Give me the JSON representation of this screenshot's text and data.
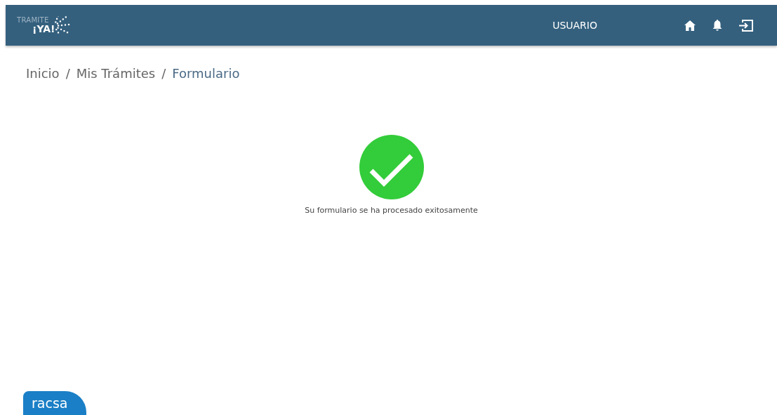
{
  "header": {
    "logo": {
      "top": "TRAMITE",
      "bottom": "¡YA!"
    },
    "user": "USUARIO",
    "icons": [
      {
        "kind": "home"
      },
      {
        "kind": "notifications"
      },
      {
        "kind": "logout"
      }
    ]
  },
  "breadcrumb": [
    {
      "label": "Inicio",
      "active": false
    },
    {
      "separator": "/"
    },
    {
      "label": "Mis Trámites",
      "active": false
    },
    {
      "separator": "/"
    },
    {
      "label": "Formulario",
      "active": true
    }
  ],
  "result": {
    "kind": "success",
    "message": "Su formulario se ha procesado exitosamente"
  },
  "footer_logo": {
    "text": "racsa"
  }
}
